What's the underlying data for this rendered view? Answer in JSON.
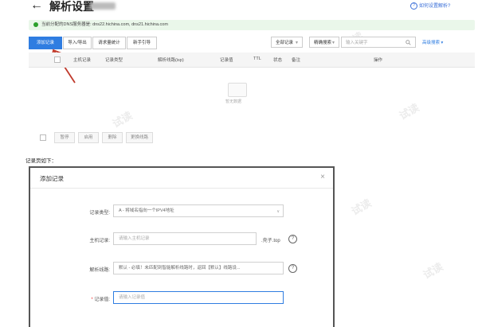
{
  "header": {
    "back_glyph": "←",
    "title": "解析设置",
    "help_link": "如何设置解析?"
  },
  "notice": {
    "text": "当前分配的DNS服务器是: dns22.hichina.com, dns21.hichina.com"
  },
  "toolbar": {
    "add_record": "添加记录",
    "import_export": "导入/导出",
    "request_stats": "请求量统计",
    "new_guide": "新手引导",
    "filter_all": "全部记录",
    "search_mode": "精确搜索",
    "search_placeholder": "输入关键字",
    "advanced_search": "高级搜索"
  },
  "table": {
    "headers": [
      "主机记录",
      "记录类型",
      "解析线路(isp)",
      "记录值",
      "TTL",
      "状态",
      "备注",
      "操作"
    ],
    "empty_text": "暂无数据"
  },
  "footer_actions": [
    "暂停",
    "启用",
    "删除",
    "更换线路"
  ],
  "section_label": "记录页如下：",
  "modal": {
    "title": "添加记录",
    "close_glyph": "×",
    "fields": {
      "record_type": {
        "label": "记录类型:",
        "value": "A - 将域名指向一个IPV4地址"
      },
      "host": {
        "label": "主机记录:",
        "placeholder": "请输入主机记录",
        "suffix": ".壳子.top"
      },
      "line": {
        "label": "解析线路:",
        "value": "默认 - 必填！未匹配到智能解析线路时，返回【默认】线路设..."
      },
      "value": {
        "label": "记录值:",
        "placeholder": "请输入记录值",
        "required_mark": "*"
      }
    }
  },
  "watermark": "试读",
  "colors": {
    "primary": "#2f7de1",
    "notice_bg": "#eaf7ea",
    "annotation_arrow": "#c0392b"
  },
  "icons": [
    "back-arrow-icon",
    "help-circle-icon",
    "status-dot-icon",
    "search-icon",
    "chevron-down-icon",
    "empty-box-icon",
    "close-icon",
    "question-icon"
  ]
}
